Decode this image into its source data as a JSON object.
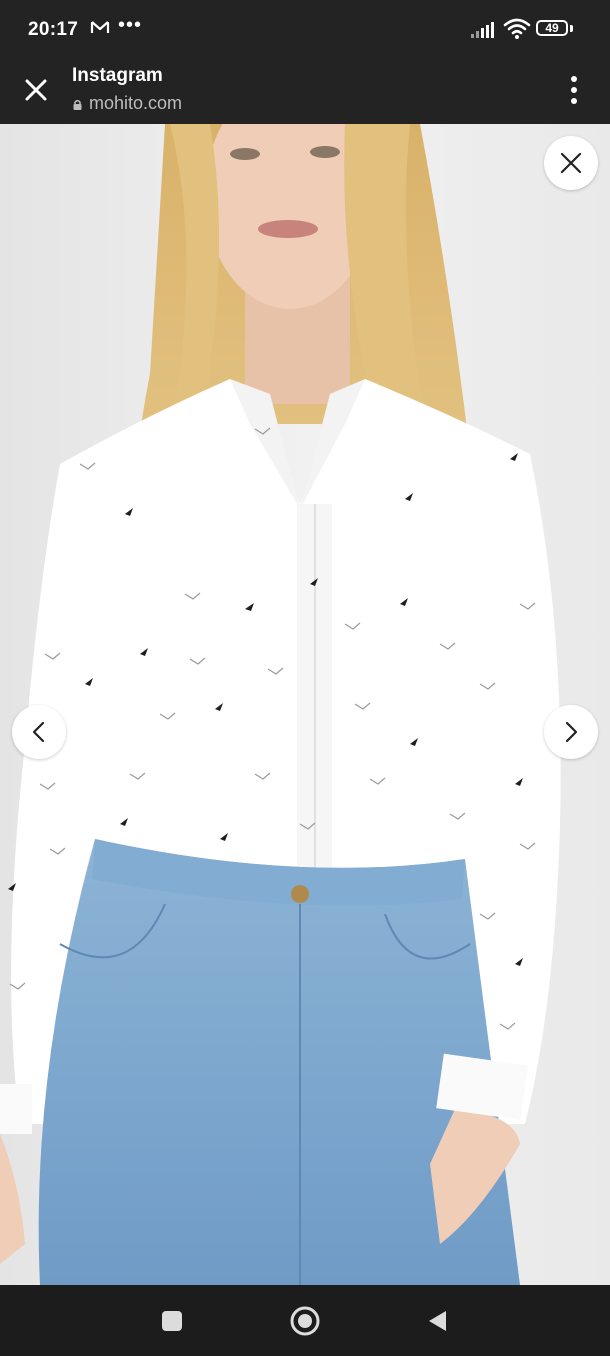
{
  "status_bar": {
    "time": "20:17",
    "notification_icons": [
      "gmail-icon",
      "more-notifications-icon"
    ],
    "system_icons": [
      "signal-icon",
      "wifi-icon",
      "battery-icon"
    ],
    "battery_level": "49"
  },
  "browser_header": {
    "title": "Instagram",
    "url": "mohito.com",
    "icons": [
      "close-icon",
      "lock-icon",
      "overflow-menu-icon"
    ]
  },
  "product_image": {
    "description_icons": [
      "close-icon",
      "chevron-left-icon",
      "chevron-right-icon"
    ]
  },
  "navigation_bar": {
    "buttons": [
      "recents-button",
      "home-button",
      "back-button"
    ]
  },
  "colors": {
    "bar_background": "#232323",
    "nav_background": "#1c1c1c",
    "image_background": "#ececec",
    "button_background": "#ffffff"
  }
}
